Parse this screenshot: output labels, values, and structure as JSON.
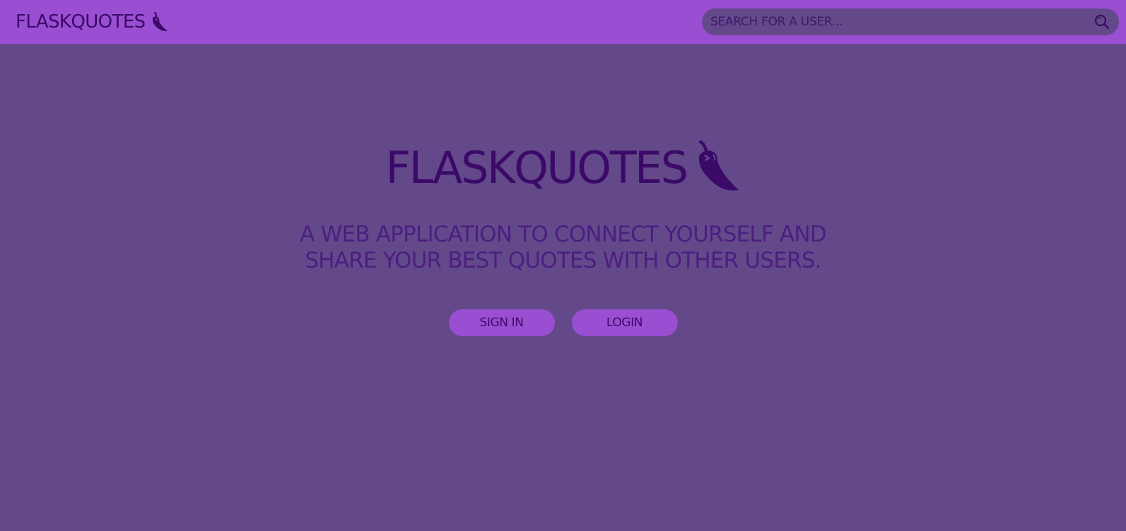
{
  "colors": {
    "navbar_bg": "#9a4ed2",
    "page_bg": "#63498a",
    "text_dark": "#3b0a68",
    "subtitle_text": "#4c1e80",
    "button_bg": "#9a4ed2"
  },
  "navbar": {
    "brand": "FLASKQUOTES",
    "brand_icon": "chili-pepper-icon",
    "search": {
      "placeholder": "SEARCH FOR A USER...",
      "value": "",
      "icon": "search-icon"
    }
  },
  "hero": {
    "title": "FLASKQUOTES",
    "title_icon": "chili-pepper-icon",
    "subtitle_line1": "A WEB APPLICATION TO CONNECT YOURSELF AND",
    "subtitle_line2": "SHARE YOUR BEST QUOTES WITH OTHER USERS."
  },
  "actions": {
    "signin_label": "SIGN IN",
    "login_label": "LOGIN"
  }
}
